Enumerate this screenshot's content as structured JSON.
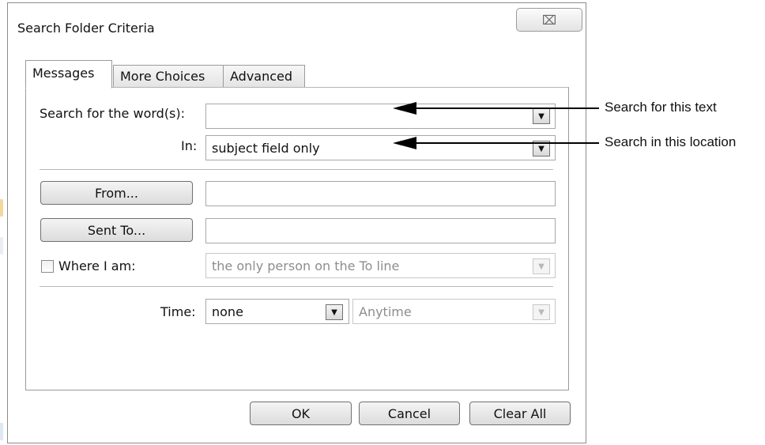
{
  "dialog": {
    "title": "Search Folder Criteria",
    "close_symbol": "⌧"
  },
  "tabs": [
    {
      "label": "Messages",
      "active": true
    },
    {
      "label": "More Choices",
      "active": false
    },
    {
      "label": "Advanced",
      "active": false
    }
  ],
  "messages_tab": {
    "search_words_label": "Search for the word(s):",
    "search_words_value": "",
    "in_label": "In:",
    "in_value": "subject field only",
    "from_button": "From...",
    "from_value": "",
    "sent_to_button": "Sent To...",
    "sent_to_value": "",
    "where_i_am_label": "Where I am:",
    "where_i_am_checked": false,
    "where_i_am_value": "the only person on the To line",
    "time_label": "Time:",
    "time_value": "none",
    "time_range_value": "Anytime"
  },
  "footer": {
    "ok": "OK",
    "cancel": "Cancel",
    "clear_all": "Clear All"
  },
  "callouts": [
    {
      "text": "Search for this text"
    },
    {
      "text": "Search in this location"
    }
  ],
  "icons": {
    "dropdown": "▼",
    "dropdown_arrow_name": "chevron-down-icon"
  }
}
